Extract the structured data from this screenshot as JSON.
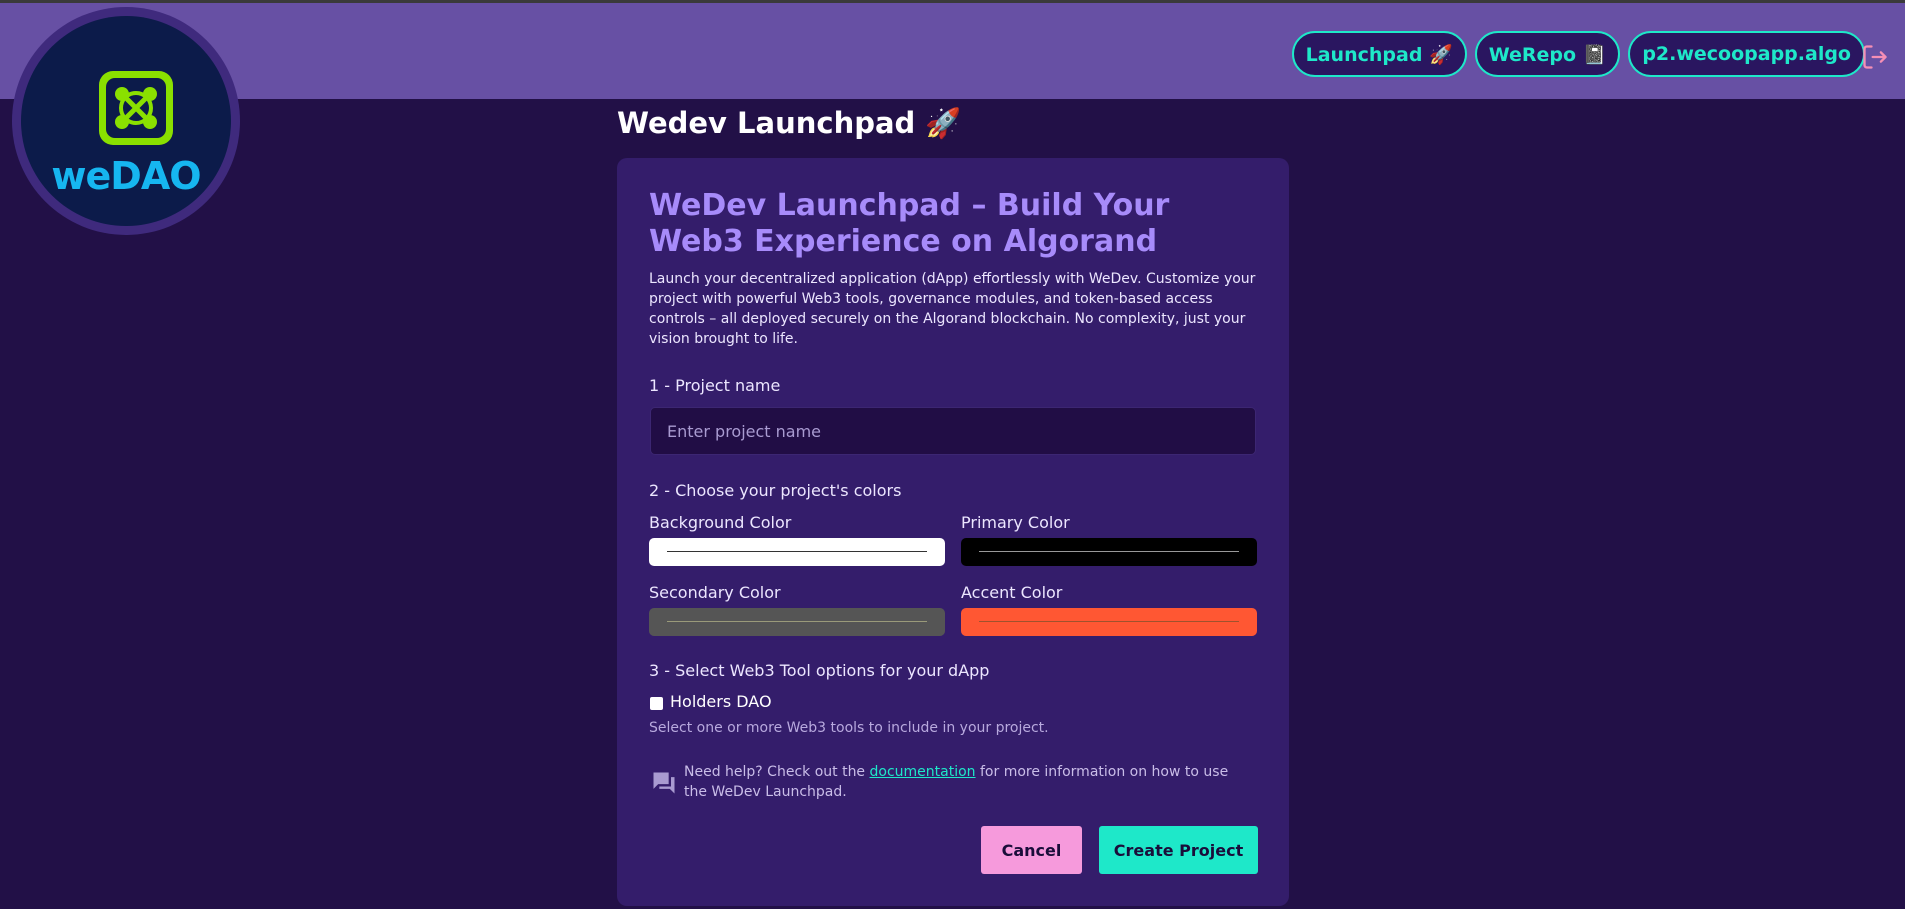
{
  "header": {
    "logo_text": "weDAO",
    "nav": [
      {
        "label": "Launchpad 🚀"
      },
      {
        "label": "WeRepo 📓"
      },
      {
        "label": "p2.wecoopapp.algo"
      }
    ]
  },
  "page": {
    "title": "Wedev Launchpad 🚀"
  },
  "card": {
    "title": "WeDev Launchpad – Build Your Web3 Experience on Algorand",
    "description": "Launch your decentralized application (dApp) effortlessly with WeDev. Customize your project with powerful Web3 tools, governance modules, and token-based access controls – all deployed securely on the Algorand blockchain. No complexity, just your vision brought to life.",
    "step1": {
      "label": "1 - Project name",
      "placeholder": "Enter project name",
      "value": ""
    },
    "step2": {
      "label": "2 - Choose your project's colors",
      "colors": [
        {
          "label": "Background Color",
          "value": "#ffffff"
        },
        {
          "label": "Primary Color",
          "value": "#000000"
        },
        {
          "label": "Secondary Color",
          "value": "#555555"
        },
        {
          "label": "Accent Color",
          "value": "#ff5733"
        }
      ]
    },
    "step3": {
      "label": "3 - Select Web3 Tool options for your dApp",
      "options": [
        {
          "label": "Holders DAO",
          "checked": false
        }
      ],
      "hint": "Select one or more Web3 tools to include in your project."
    },
    "help": {
      "prefix": "Need help? Check out the ",
      "link": "documentation",
      "suffix": " for more information on how to use the WeDev Launchpad."
    },
    "buttons": {
      "cancel": "Cancel",
      "create": "Create Project"
    }
  },
  "colors": {
    "accent": "#1ee8c9",
    "header_bg": "#6750a4",
    "page_bg": "#221047",
    "card_bg": "#341d6b",
    "cancel_bg": "#f69adc"
  }
}
